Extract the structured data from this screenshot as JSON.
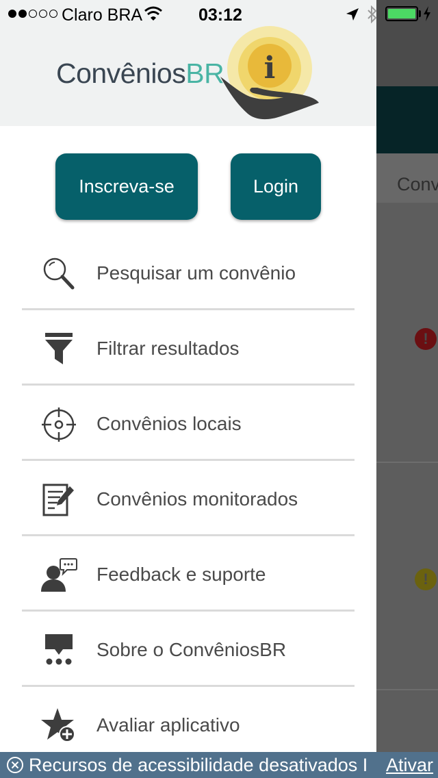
{
  "status_bar": {
    "carrier": "Claro BRA",
    "time": "03:12",
    "signal_bars": 2,
    "battery_level": 1.0
  },
  "background": {
    "tab_label": "Conv"
  },
  "drawer": {
    "logo": {
      "name": "Convênios",
      "suffix": "BR"
    },
    "buttons": {
      "signup": "Inscreva-se",
      "login": "Login"
    },
    "menu": [
      {
        "label": "Pesquisar um convênio",
        "icon": "search-icon"
      },
      {
        "label": "Filtrar resultados",
        "icon": "filter-icon"
      },
      {
        "label": "Convênios locais",
        "icon": "crosshair-icon"
      },
      {
        "label": "Convênios monitorados",
        "icon": "document-edit-icon"
      },
      {
        "label": "Feedback e suporte",
        "icon": "feedback-support-icon"
      },
      {
        "label": "Sobre o ConvêniosBR",
        "icon": "about-icon"
      },
      {
        "label": "Avaliar aplicativo",
        "icon": "rate-star-icon"
      }
    ]
  },
  "accessibility_bar": {
    "text": "Recursos de acessibilidade desativados I",
    "link": "Ativar"
  },
  "colors": {
    "brand_teal": "#06606a",
    "logo_accent": "#49b4a4",
    "alert_red": "#6b0f12",
    "alert_yellow": "#6b620f",
    "a11y_bar": "#51718c"
  }
}
